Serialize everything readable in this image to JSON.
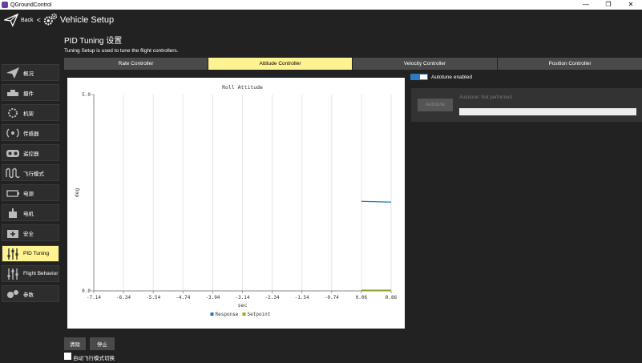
{
  "window": {
    "title": "QGroundControl",
    "controls": {
      "minimize": "—",
      "maximize": "❐",
      "close": "✕"
    }
  },
  "toolbar": {
    "back_label": "Back",
    "separator": "<",
    "title": "Vehicle Setup"
  },
  "sidebar": {
    "items": [
      {
        "label": "概况",
        "icon": "plane-icon"
      },
      {
        "label": "摄件",
        "icon": "airframe-icon"
      },
      {
        "label": "机架",
        "icon": "frame-icon"
      },
      {
        "label": "传感器",
        "icon": "sensors-icon"
      },
      {
        "label": "遥控器",
        "icon": "radio-icon"
      },
      {
        "label": "飞行模式",
        "icon": "flight-modes-icon"
      },
      {
        "label": "电源",
        "icon": "power-icon"
      },
      {
        "label": "电机",
        "icon": "motors-icon"
      },
      {
        "label": "安全",
        "icon": "safety-icon"
      },
      {
        "label": "PID Tuning",
        "icon": "tuning-icon"
      },
      {
        "label": "Flight Behavior",
        "icon": "behavior-icon"
      },
      {
        "label": "参数",
        "icon": "parameters-icon"
      }
    ]
  },
  "main": {
    "title": "PID Tuning 设置",
    "description": "Tuning Setup is used to tune the flight controllers.",
    "tabs": [
      {
        "label": "Rate Controller"
      },
      {
        "label": "Attitude Controller"
      },
      {
        "label": "Velocity Controller"
      },
      {
        "label": "Position Controller"
      }
    ],
    "active_tab": 1
  },
  "chart_data": {
    "type": "line",
    "title": "Roll Attitude",
    "xlabel": "sec",
    "ylabel": "deg",
    "xlim": [
      -7.14,
      0.86
    ],
    "ylim": [
      0.0,
      5.0
    ],
    "x_ticks": [
      "-7.14",
      "-6.34",
      "-5.54",
      "-4.74",
      "-3.94",
      "-3.14",
      "-2.34",
      "-1.54",
      "-0.74",
      "0.06",
      "0.86"
    ],
    "y_ticks": [
      "5.0",
      "0.0"
    ],
    "grid": true,
    "legend_position": "bottom-center",
    "series": [
      {
        "name": "Response",
        "color": "#1f77b4",
        "x": [
          0.06,
          0.86
        ],
        "y": [
          2.28,
          2.26
        ]
      },
      {
        "name": "Setpoint",
        "color": "#8db600",
        "x": [
          0.06,
          0.86
        ],
        "y": [
          0.02,
          0.02
        ]
      }
    ]
  },
  "autotune": {
    "enabled_label": "Autotune enabled",
    "enabled": true,
    "button_label": "Autotune",
    "status": "Autotune: Not performed",
    "progress": 0
  },
  "controls": {
    "clear_label": "清除",
    "stop_label": "停止",
    "auto_switch_label": "自动飞行模式切换"
  },
  "colors": {
    "accent": "#fff291",
    "background": "#222222",
    "toggle": "#2e7bc4"
  }
}
